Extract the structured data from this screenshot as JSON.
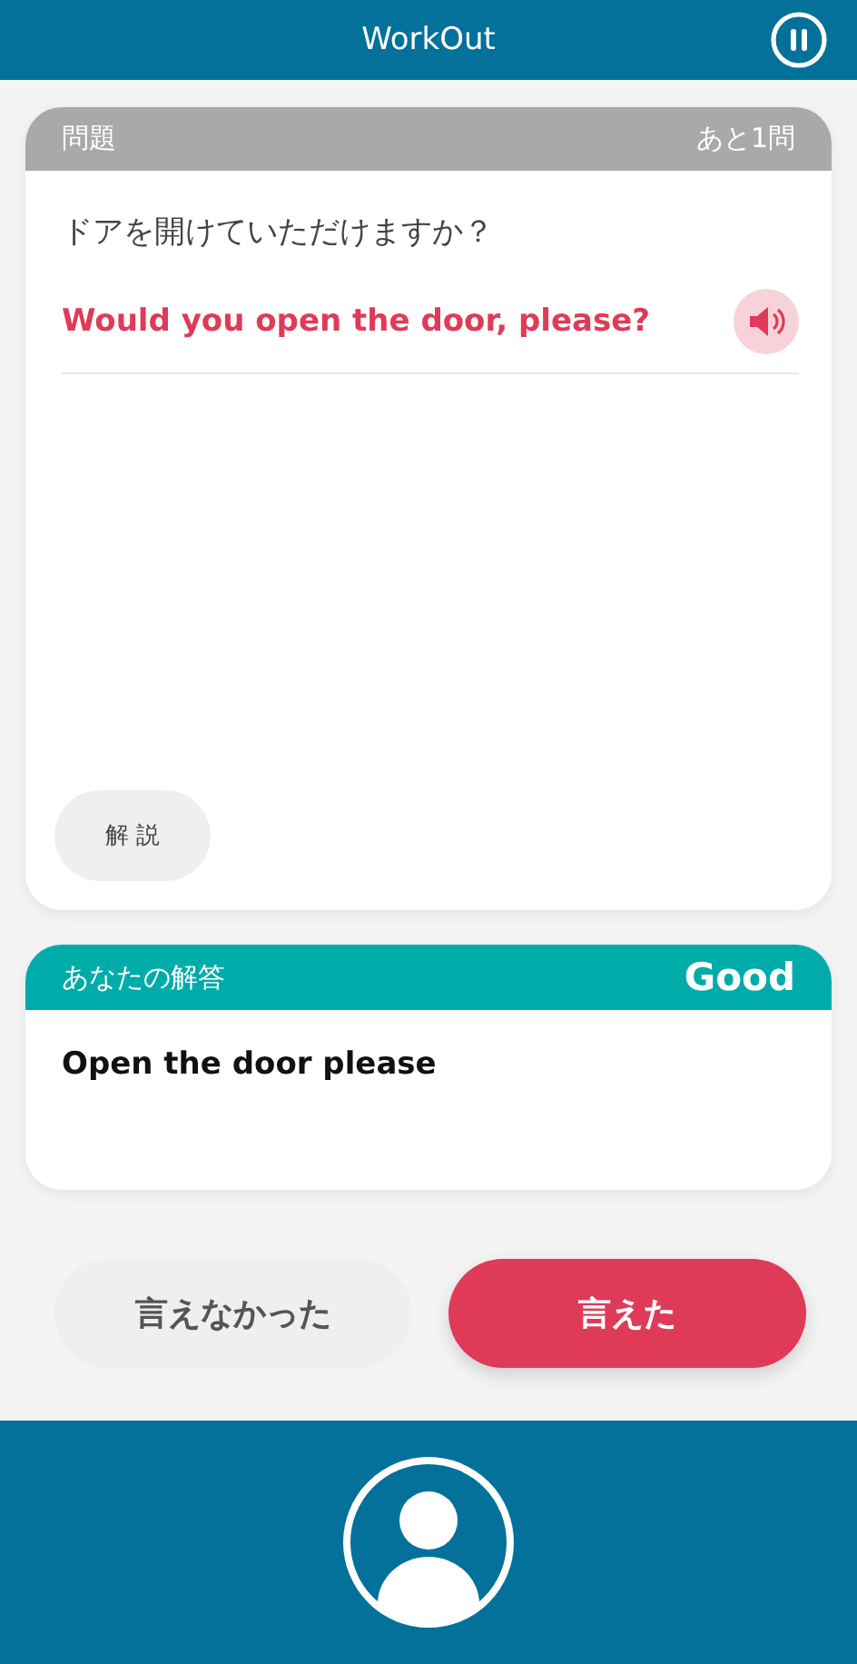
{
  "header": {
    "title": "WorkOut"
  },
  "question_card": {
    "label": "問題",
    "remaining": "あと1問",
    "prompt": "ドアを開けていただけますか？",
    "answer": "Would you open the door, please?",
    "explain_button": "解 説"
  },
  "answer_card": {
    "label": "あなたの解答",
    "grade": "Good",
    "text": "Open the door please"
  },
  "buttons": [
    {
      "label": "言えなかった",
      "kind": "secondary"
    },
    {
      "label": "言えた",
      "kind": "primary"
    }
  ]
}
